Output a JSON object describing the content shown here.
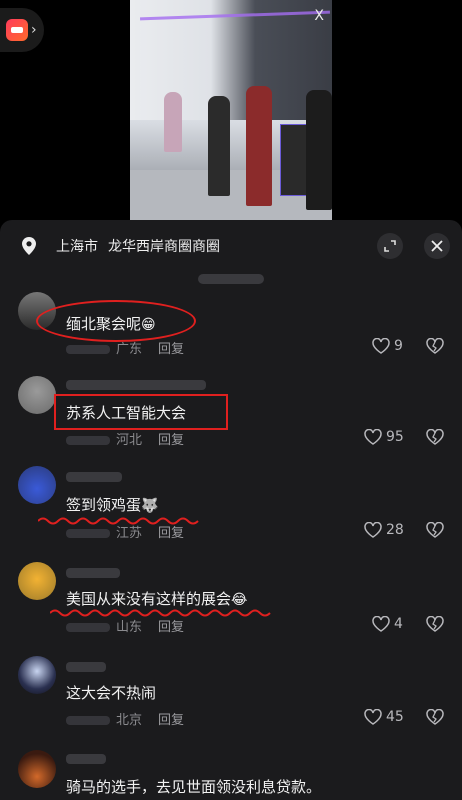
{
  "location": {
    "city": "上海市",
    "place": "龙华西岸商圈商圈"
  },
  "comments": [
    {
      "text": "缅北聚会呢",
      "emoji": "😁",
      "region": "广东",
      "reply": "回复",
      "likes": "9"
    },
    {
      "text": "苏系人工智能大会",
      "emoji": "",
      "region": "河北",
      "reply": "回复",
      "likes": "95"
    },
    {
      "text": "签到领鸡蛋",
      "emoji": "🐺",
      "region": "江苏",
      "reply": "回复",
      "likes": "28"
    },
    {
      "text": "美国从来没有这样的展会",
      "emoji": "😂",
      "region": "山东",
      "reply": "回复",
      "likes": "4"
    },
    {
      "text": "这大会不热闹",
      "emoji": "",
      "region": "北京",
      "reply": "回复",
      "likes": "45"
    },
    {
      "text": "骑马的选手，去见世面领没利息贷款。",
      "emoji": "",
      "region": "",
      "reply": "",
      "likes": ""
    }
  ],
  "video": {
    "booth_logo": "X"
  },
  "colors": {
    "annotation_red": "#e0201f",
    "sheet_bg": "#1b1b1d",
    "app_icon": "#ff3b5c"
  },
  "icons": {
    "location": "location-pin-icon",
    "expand": "expand-icon",
    "close": "close-icon",
    "like": "heart-icon",
    "dislike": "broken-heart-icon"
  }
}
